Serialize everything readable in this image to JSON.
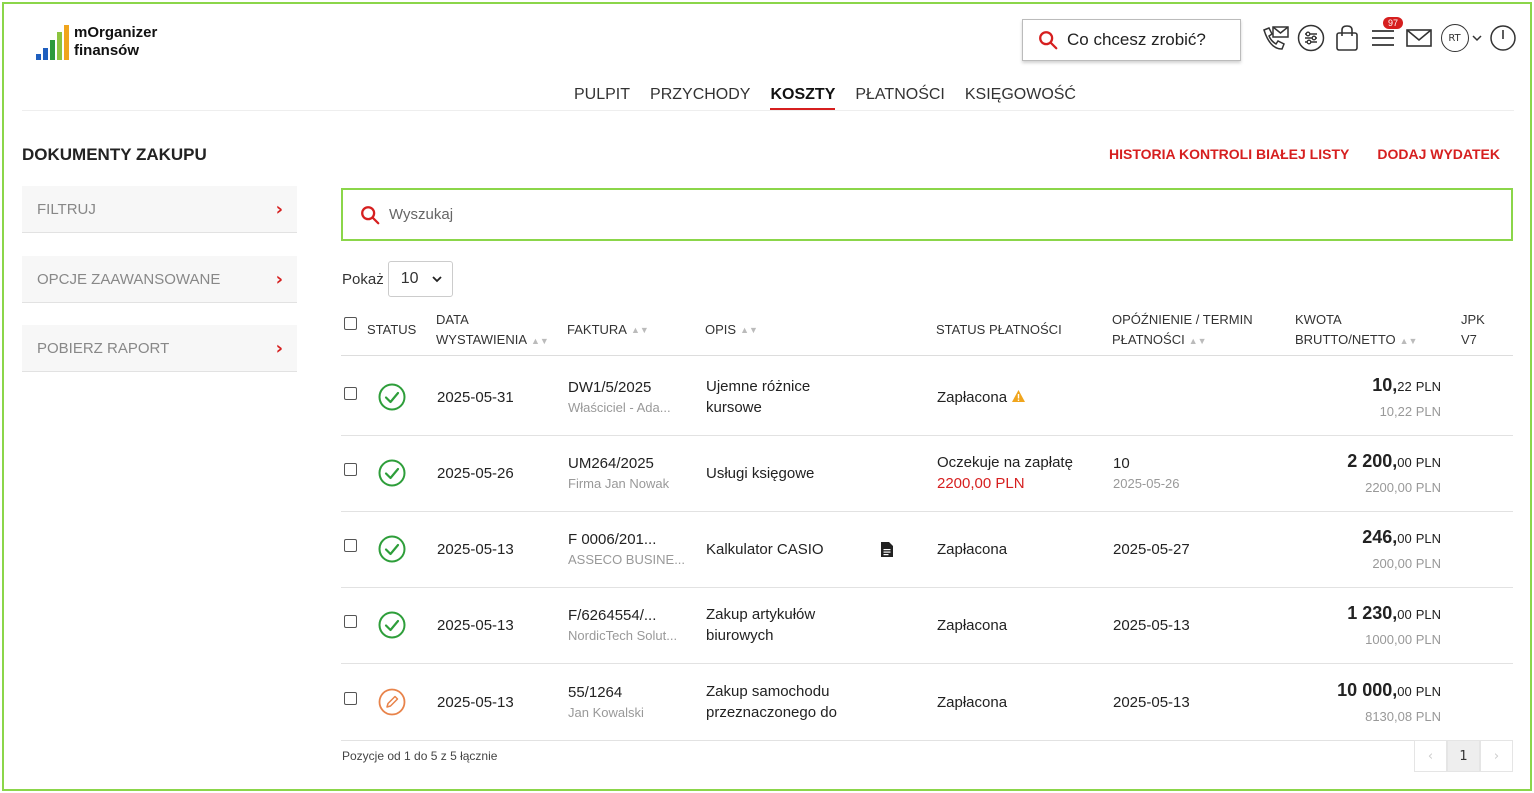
{
  "app": {
    "logo_line1": "mOrganizer",
    "logo_line2": "finansów",
    "brand_colors": [
      "#1f5fbf",
      "#2b9a3a",
      "#8cc43f",
      "#f0a51d"
    ]
  },
  "top_search": {
    "placeholder": "Co chcesz zrobić?",
    "icon": "search-icon"
  },
  "header_icons": {
    "phone": "phone-mail-icon",
    "settings": "sliders-icon",
    "cart": "bag-icon",
    "tasks": "list-icon",
    "tasks_badge": "97",
    "mail": "mail-icon",
    "avatar_initials": "RT",
    "power": "power-icon"
  },
  "nav": {
    "items": [
      {
        "label": "PULPIT"
      },
      {
        "label": "PRZYCHODY"
      },
      {
        "label": "KOSZTY"
      },
      {
        "label": "PŁATNOŚCI"
      },
      {
        "label": "KSIĘGOWOŚĆ"
      }
    ],
    "active": "KOSZTY"
  },
  "page": {
    "title": "DOKUMENTY ZAKUPU",
    "link_history": "HISTORIA KONTROLI BIAŁEJ LISTY",
    "link_add": "DODAJ WYDATEK"
  },
  "sidebar": {
    "items": [
      {
        "label": "FILTRUJ"
      },
      {
        "label": "OPCJE ZAAWANSOWANE"
      },
      {
        "label": "POBIERZ RAPORT"
      }
    ]
  },
  "search": {
    "placeholder": "Wyszukaj"
  },
  "page_size": {
    "label": "Pokaż",
    "value": "10"
  },
  "table": {
    "headers": {
      "status": "STATUS",
      "date_1": "DATA",
      "date_2": "WYSTAWIENIA",
      "invoice": "FAKTURA",
      "desc": "OPIS",
      "pay_status": "STATUS PŁATNOŚCI",
      "delay_1": "OPÓŹNIENIE / TERMIN",
      "delay_2": "PŁATNOŚCI",
      "amount_1": "KWOTA",
      "amount_2": "BRUTTO/NETTO",
      "jpk_1": "JPK",
      "jpk_2": "V7"
    },
    "rows": [
      {
        "status": "ok",
        "date": "2025-05-31",
        "invoice": "DW1/5/2025",
        "party": "Właściciel - Ada...",
        "desc_1": "Ujemne różnice",
        "desc_2": "kursowe",
        "pay": "Zapłacona",
        "pay_extra": "",
        "warn": true,
        "delay_main": "",
        "delay_sub": "",
        "gross_int": "10,",
        "gross_dec": "22",
        "currency": "PLN",
        "net": "10,22 PLN",
        "attachment": false
      },
      {
        "status": "ok",
        "date": "2025-05-26",
        "invoice": "UM264/2025",
        "party": "Firma Jan Nowak",
        "desc_1": "Usługi księgowe",
        "desc_2": "",
        "pay": "Oczekuje na zapłatę",
        "pay_extra": "2200,00 PLN",
        "warn": false,
        "delay_main": "10",
        "delay_sub": "2025-05-26",
        "gross_int": "2 200,",
        "gross_dec": "00",
        "currency": "PLN",
        "net": "2200,00 PLN",
        "attachment": false
      },
      {
        "status": "ok",
        "date": "2025-05-13",
        "invoice": "F 0006/201...",
        "party": "ASSECO BUSINE...",
        "desc_1": "Kalkulator CASIO",
        "desc_2": "",
        "pay": "Zapłacona",
        "pay_extra": "",
        "warn": false,
        "delay_main": "2025-05-27",
        "delay_sub": "",
        "gross_int": "246,",
        "gross_dec": "00",
        "currency": "PLN",
        "net": "200,00 PLN",
        "attachment": true
      },
      {
        "status": "ok",
        "date": "2025-05-13",
        "invoice": "F/6264554/...",
        "party": "NordicTech Solut...",
        "desc_1": "Zakup artykułów",
        "desc_2": "biurowych",
        "pay": "Zapłacona",
        "pay_extra": "",
        "warn": false,
        "delay_main": "2025-05-13",
        "delay_sub": "",
        "gross_int": "1 230,",
        "gross_dec": "00",
        "currency": "PLN",
        "net": "1000,00 PLN",
        "attachment": false
      },
      {
        "status": "draft",
        "date": "2025-05-13",
        "invoice": "55/1264",
        "party": "Jan Kowalski",
        "desc_1": "Zakup samochodu",
        "desc_2": "przeznaczonego do",
        "pay": "Zapłacona",
        "pay_extra": "",
        "warn": false,
        "delay_main": "2025-05-13",
        "delay_sub": "",
        "gross_int": "10 000,",
        "gross_dec": "00",
        "currency": "PLN",
        "net": "8130,08 PLN",
        "attachment": false
      }
    ]
  },
  "footer": {
    "info": "Pozycje od 1 do 5 z 5 łącznie",
    "page": "1",
    "prev": "‹",
    "next": "›"
  },
  "colors": {
    "accent_red": "#d61f1f",
    "ok_green": "#2e9e3a",
    "draft_orange": "#e8834a",
    "frame_green": "#8bd64a",
    "warn_yellow": "#f0a51d"
  }
}
